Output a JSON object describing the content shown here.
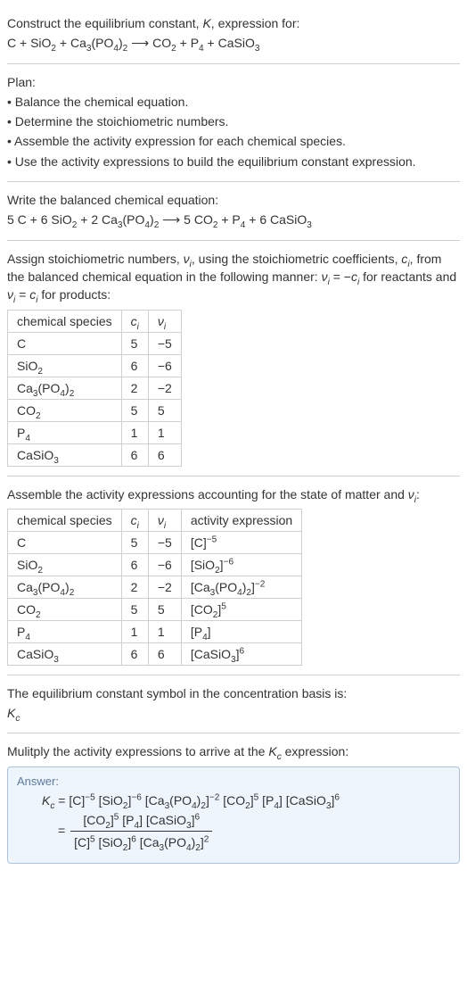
{
  "section1": {
    "line1a": "Construct the equilibrium constant, ",
    "K": "K",
    "line1b": ", expression for:",
    "eq_left": "C + SiO",
    "eq_sio2_sub": "2",
    "eq_plus1": " + Ca",
    "eq_ca3_sub": "3",
    "eq_po4": "(PO",
    "eq_po4_sub": "4",
    "eq_po4_close": ")",
    "eq_po4_2": "2",
    "eq_arrow": " ⟶ ",
    "eq_co2": "CO",
    "eq_co2_sub": "2",
    "eq_plus2": " + P",
    "eq_p4_sub": "4",
    "eq_plus3": " + CaSiO",
    "eq_casio3_sub": "3"
  },
  "section2": {
    "title": "Plan:",
    "b1": "• Balance the chemical equation.",
    "b2": "• Determine the stoichiometric numbers.",
    "b3": "• Assemble the activity expression for each chemical species.",
    "b4": "• Use the activity expressions to build the equilibrium constant expression."
  },
  "section3": {
    "line1": "Write the balanced chemical equation:",
    "eq": {
      "c_coef": "5 C + 6 SiO",
      "sio2_sub": "2",
      "plus1": " + 2 Ca",
      "ca3_sub": "3",
      "po4": "(PO",
      "po4_sub": "4",
      "po4_close": ")",
      "po4_2": "2",
      "arrow": " ⟶ ",
      "co2": "5 CO",
      "co2_sub": "2",
      "plus2": " + P",
      "p4_sub": "4",
      "plus3": " + 6 CaSiO",
      "casio3_sub": "3"
    }
  },
  "section4": {
    "text1a": "Assign stoichiometric numbers, ",
    "nu": "ν",
    "sub_i": "i",
    "text1b": ", using the stoichiometric coefficients, ",
    "c": "c",
    "text1c": ", from the balanced chemical equation in the following manner: ",
    "eq1": " = −",
    "text1d": " for reactants and ",
    "eq2": " = ",
    "text1e": " for products:",
    "table": {
      "h1": "chemical species",
      "h2_c": "c",
      "h2_i": "i",
      "h3_nu": "ν",
      "h3_i": "i",
      "rows": [
        {
          "species_html": "C",
          "c": "5",
          "nu": "−5"
        },
        {
          "species_html": "SiO<sub>2</sub>",
          "c": "6",
          "nu": "−6"
        },
        {
          "species_html": "Ca<sub>3</sub>(PO<sub>4</sub>)<sub>2</sub>",
          "c": "2",
          "nu": "−2"
        },
        {
          "species_html": "CO<sub>2</sub>",
          "c": "5",
          "nu": "5"
        },
        {
          "species_html": "P<sub>4</sub>",
          "c": "1",
          "nu": "1"
        },
        {
          "species_html": "CaSiO<sub>3</sub>",
          "c": "6",
          "nu": "6"
        }
      ]
    }
  },
  "section5": {
    "line1a": "Assemble the activity expressions accounting for the state of matter and ",
    "nu": "ν",
    "sub_i": "i",
    "line1b": ":",
    "table": {
      "h1": "chemical species",
      "h2_c": "c",
      "h2_i": "i",
      "h3_nu": "ν",
      "h3_i": "i",
      "h4": "activity expression",
      "rows": [
        {
          "species_html": "C",
          "c": "5",
          "nu": "−5",
          "act_html": "[C]<sup>−5</sup>"
        },
        {
          "species_html": "SiO<sub>2</sub>",
          "c": "6",
          "nu": "−6",
          "act_html": "[SiO<sub>2</sub>]<sup>−6</sup>"
        },
        {
          "species_html": "Ca<sub>3</sub>(PO<sub>4</sub>)<sub>2</sub>",
          "c": "2",
          "nu": "−2",
          "act_html": "[Ca<sub>3</sub>(PO<sub>4</sub>)<sub>2</sub>]<sup>−2</sup>"
        },
        {
          "species_html": "CO<sub>2</sub>",
          "c": "5",
          "nu": "5",
          "act_html": "[CO<sub>2</sub>]<sup>5</sup>"
        },
        {
          "species_html": "P<sub>4</sub>",
          "c": "1",
          "nu": "1",
          "act_html": "[P<sub>4</sub>]"
        },
        {
          "species_html": "CaSiO<sub>3</sub>",
          "c": "6",
          "nu": "6",
          "act_html": "[CaSiO<sub>3</sub>]<sup>6</sup>"
        }
      ]
    }
  },
  "section6": {
    "line1": "The equilibrium constant symbol in the concentration basis is:",
    "Kc_K": "K",
    "Kc_c": "c"
  },
  "section7": {
    "line1a": "Mulitply the activity expressions to arrive at the ",
    "Kc_K": "K",
    "Kc_c": "c",
    "line1b": " expression:"
  },
  "answer": {
    "label": "Answer:",
    "line1_html": "<span class=\"italic-var\">K<sub>c</sub></span> = [C]<sup>−5</sup> [SiO<sub>2</sub>]<sup>−6</sup> [Ca<sub>3</sub>(PO<sub>4</sub>)<sub>2</sub>]<sup>−2</sup> [CO<sub>2</sub>]<sup>5</sup> [P<sub>4</sub>] [CaSiO<sub>3</sub>]<sup>6</sup>",
    "eq_sign": " = ",
    "num_html": "[CO<sub>2</sub>]<sup>5</sup> [P<sub>4</sub>] [CaSiO<sub>3</sub>]<sup>6</sup>",
    "den_html": "[C]<sup>5</sup> [SiO<sub>2</sub>]<sup>6</sup> [Ca<sub>3</sub>(PO<sub>4</sub>)<sub>2</sub>]<sup>2</sup>"
  }
}
